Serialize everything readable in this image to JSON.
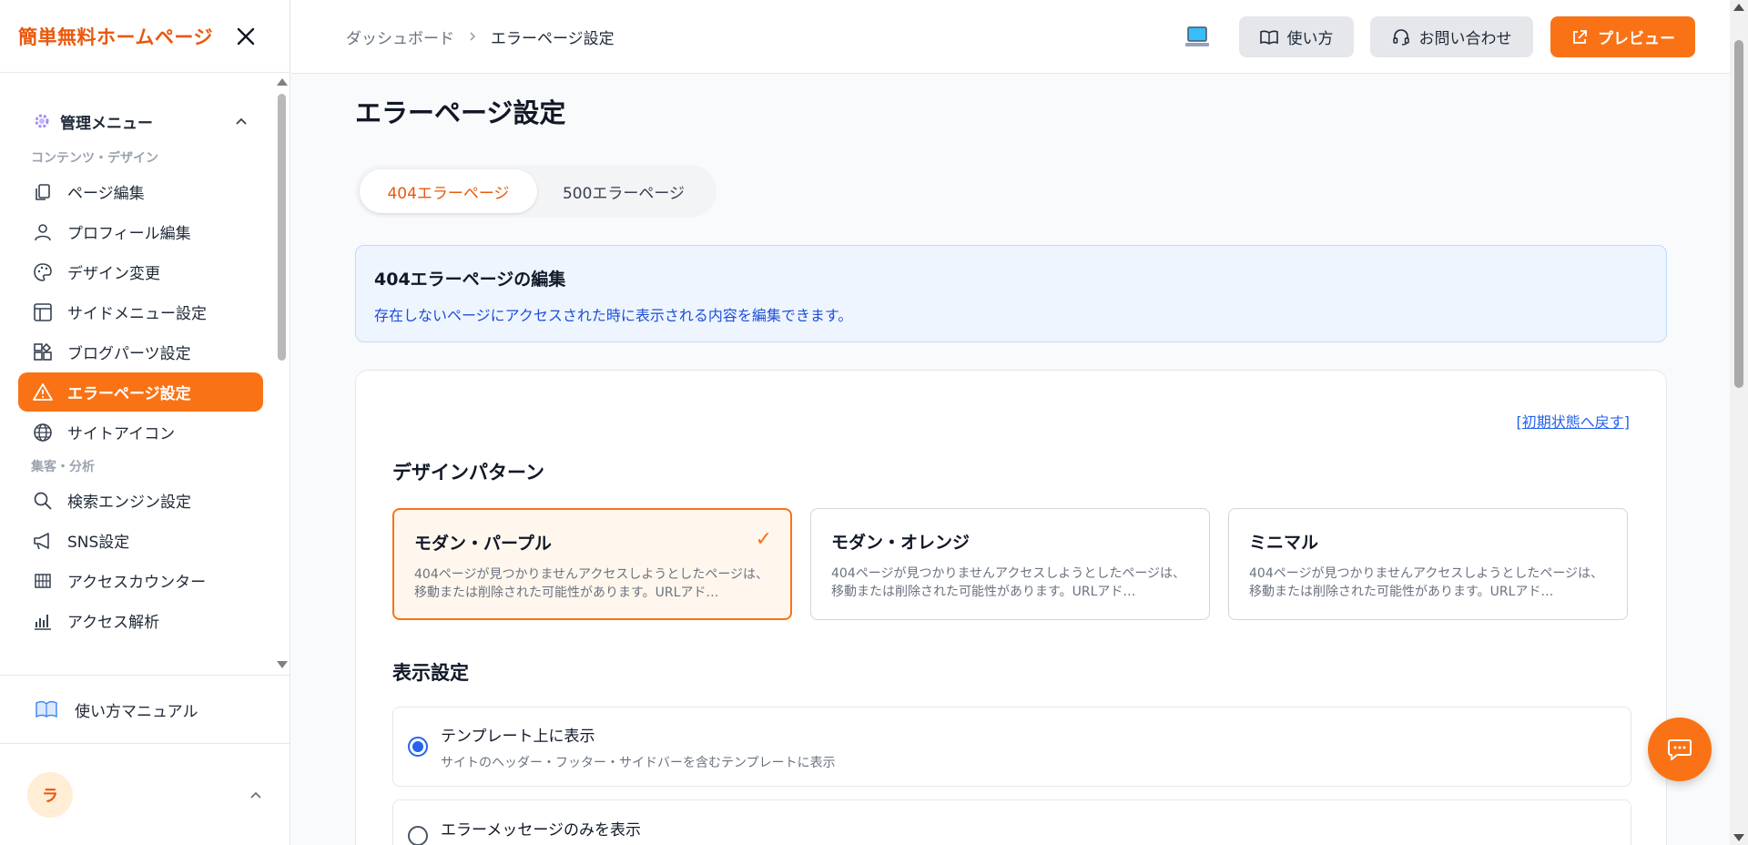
{
  "sidebar": {
    "brand": "簡単無料ホームページ",
    "menu_title": "管理メニュー",
    "section_content": "コンテンツ・デザイン",
    "items_content": [
      {
        "label": "ページ編集",
        "icon": "copy-icon"
      },
      {
        "label": "プロフィール編集",
        "icon": "user-icon"
      },
      {
        "label": "デザイン変更",
        "icon": "palette-icon"
      },
      {
        "label": "サイドメニュー設定",
        "icon": "layout-icon"
      },
      {
        "label": "ブログパーツ設定",
        "icon": "widgets-icon"
      },
      {
        "label": "エラーページ設定",
        "icon": "warning-icon",
        "active": true
      },
      {
        "label": "サイトアイコン",
        "icon": "globe-icon"
      }
    ],
    "section_analytics": "集客・分析",
    "items_analytics": [
      {
        "label": "検索エンジン設定",
        "icon": "search-icon"
      },
      {
        "label": "SNS設定",
        "icon": "megaphone-icon"
      },
      {
        "label": "アクセスカウンター",
        "icon": "grid-icon"
      },
      {
        "label": "アクセス解析",
        "icon": "bar-chart-icon"
      }
    ],
    "manual": "使い方マニュアル",
    "avatar_initial": "ラ"
  },
  "header": {
    "breadcrumb_parent": "ダッシュボード",
    "breadcrumb_current": "エラーページ設定",
    "help_label": "使い方",
    "contact_label": "お問い合わせ",
    "preview_label": "プレビュー"
  },
  "main": {
    "page_title": "エラーページ設定",
    "tabs": [
      {
        "label": "404エラーページ",
        "active": true
      },
      {
        "label": "500エラーページ",
        "active": false
      }
    ],
    "info_title": "404エラーページの編集",
    "info_desc": "存在しないページにアクセスされた時に表示される内容を編集できます。",
    "reset_link": "[初期状態へ戻す]",
    "design_heading": "デザインパターン",
    "patterns": [
      {
        "name": "モダン・パープル",
        "desc": "404ページが見つかりませんアクセスしようとしたページは、移動または削除された可能性があります。URLアド…",
        "selected": true,
        "check": "✓"
      },
      {
        "name": "モダン・オレンジ",
        "desc": "404ページが見つかりませんアクセスしようとしたページは、移動または削除された可能性があります。URLアド…",
        "selected": false
      },
      {
        "name": "ミニマル",
        "desc": "404ページが見つかりませんアクセスしようとしたページは、移動または削除された可能性があります。URLアド…",
        "selected": false
      }
    ],
    "display_heading": "表示設定",
    "display_options": [
      {
        "label": "テンプレート上に表示",
        "desc": "サイトのヘッダー・フッター・サイドバーを含むテンプレートに表示",
        "checked": true
      },
      {
        "label": "エラーメッセージのみを表示",
        "desc": "",
        "checked": false
      }
    ]
  },
  "colors": {
    "accent": "#f97316",
    "brand_text": "#ea580c",
    "link": "#2563eb"
  }
}
